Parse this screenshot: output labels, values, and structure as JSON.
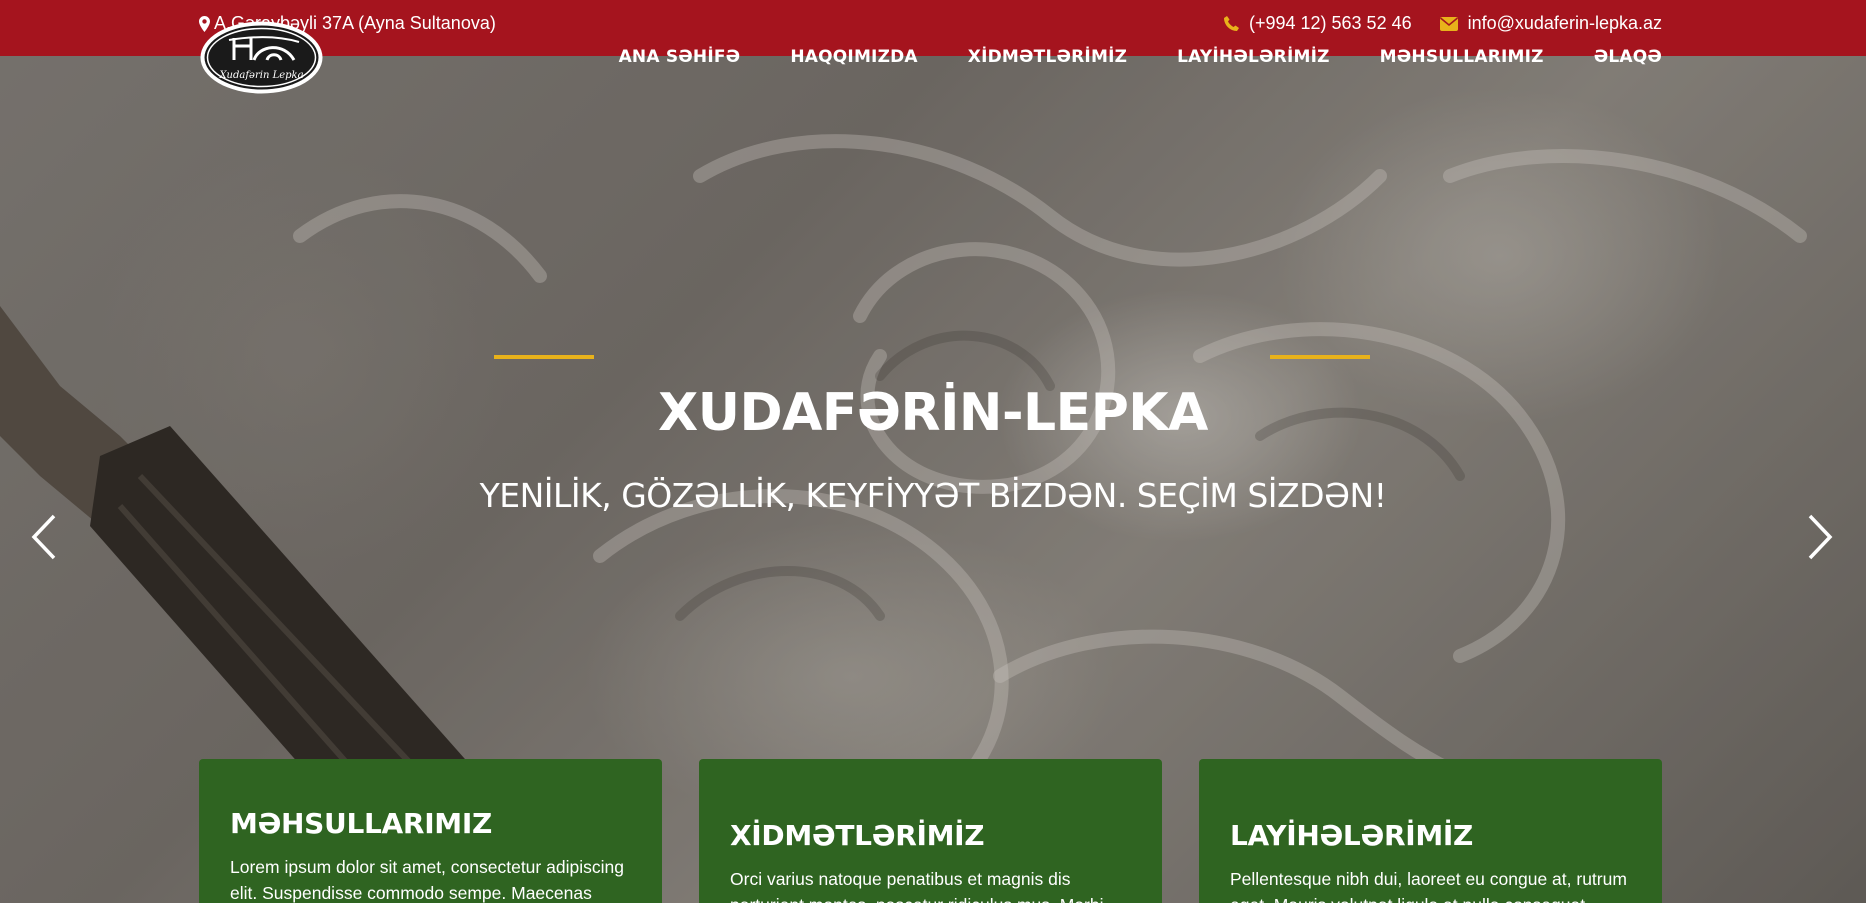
{
  "topbar": {
    "address": "A.Gəraybəyli 37A (Ayna Sultanova)",
    "phone": "(+994 12) 563 52 46",
    "email": "info@xudaferin-lepka.az",
    "icons": [
      "map-marker-icon",
      "phone-icon",
      "envelope-icon"
    ],
    "accent_color": "#e8b21b",
    "bg_color": "#a5141e"
  },
  "logo": {
    "text": "Xudafərin Lepka"
  },
  "nav": {
    "items": [
      "ANA SƏHİFƏ",
      "HAQQIMIZDA",
      "XİDMƏTLƏRİMİZ",
      "LAYİHƏLƏRİMİZ",
      "MƏHSULLARIMIZ",
      "ƏLAQƏ"
    ]
  },
  "hero": {
    "title": "XUDAFƏRİN-LEPKA",
    "subtitle": "YENİLİK, GÖZƏLLİK, KEYFİYYƏT BİZDƏN. SEÇİM SİZDƏN!",
    "prev_icon": "chevron-left-icon",
    "next_icon": "chevron-right-icon"
  },
  "cards": [
    {
      "title": "MƏHSULLARIMIZ",
      "text": "Lorem ipsum dolor sit amet, consectetur adipiscing elit. Suspendisse commodo sempe. Maecenas"
    },
    {
      "title": "XİDMƏTLƏRİMİZ",
      "text": "Orci varius natoque penatibus et magnis dis parturient montes, nascetur ridiculus mus. Morbi"
    },
    {
      "title": "LAYİHƏLƏRİMİZ",
      "text": "Pellentesque nibh dui, laoreet eu congue at, rutrum eget. Mauris volutpat ligula at nulla consequat"
    }
  ],
  "card_color": "#2f6421"
}
